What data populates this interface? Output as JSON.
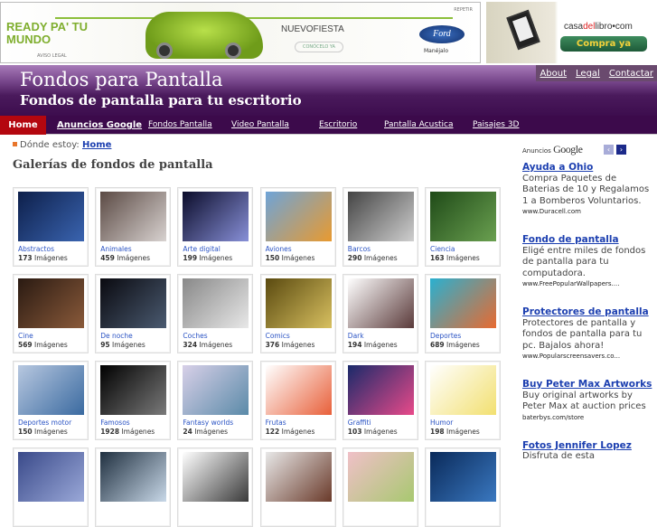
{
  "banner_ad": {
    "headline": "READY PA' TU MUNDO",
    "aviso": "AVISO LEGAL",
    "product": "NUEVOFIESTA",
    "cta": "CONÓCELO YA",
    "brand": "Ford",
    "tagline": "Manéjalo",
    "replay": "REPETIR"
  },
  "side_banner": {
    "brand_a": "casa",
    "brand_b": "del",
    "brand_c": "libro•com",
    "cta": "Compra ya"
  },
  "header": {
    "title": "Fondos para Pantalla",
    "subtitle": "Fondos de pantalla para tu escritorio",
    "links": [
      "About",
      "Legal",
      "Contactar"
    ]
  },
  "nav": {
    "items": [
      "Home",
      "Anuncios Google",
      "Fondos Pantalla",
      "Video Pantalla",
      "Escritorio",
      "Pantalla Acustica",
      "Paisajes 3D"
    ]
  },
  "breadcrumb": {
    "label": "Dónde estoy:",
    "current": "Home"
  },
  "main": {
    "title": "Galerías de fondos de pantalla",
    "count_suffix": " Imágenes",
    "galleries": [
      {
        "name": "Abstractos",
        "count": "173",
        "c1": "#0d1f4a",
        "c2": "#3a64b0"
      },
      {
        "name": "Animales",
        "count": "459",
        "c1": "#5b4a44",
        "c2": "#d8d2d0"
      },
      {
        "name": "Arte digital",
        "count": "199",
        "c1": "#0b0c2a",
        "c2": "#8890d8"
      },
      {
        "name": "Aviones",
        "count": "150",
        "c1": "#6ea4d8",
        "c2": "#e89a30"
      },
      {
        "name": "Barcos",
        "count": "290",
        "c1": "#444444",
        "c2": "#cfcfcf"
      },
      {
        "name": "Ciencia",
        "count": "163",
        "c1": "#1f4a18",
        "c2": "#6aa050"
      },
      {
        "name": "Cine",
        "count": "569",
        "c1": "#2a1a12",
        "c2": "#8a5a3a"
      },
      {
        "name": "De noche",
        "count": "95",
        "c1": "#0a0a10",
        "c2": "#4a5a70"
      },
      {
        "name": "Coches",
        "count": "324",
        "c1": "#888888",
        "c2": "#e8e8e8"
      },
      {
        "name": "Comics",
        "count": "376",
        "c1": "#5a4a10",
        "c2": "#d8c060"
      },
      {
        "name": "Dark",
        "count": "194",
        "c1": "#ffffff",
        "c2": "#5a3a3a"
      },
      {
        "name": "Deportes",
        "count": "689",
        "c1": "#2ab0d0",
        "c2": "#e86a30"
      },
      {
        "name": "Deportes motor",
        "count": "150",
        "c1": "#b8c8e0",
        "c2": "#3a6aa0"
      },
      {
        "name": "Famosos",
        "count": "1928",
        "c1": "#000000",
        "c2": "#7a7a7a"
      },
      {
        "name": "Fantasy worlds",
        "count": "24",
        "c1": "#d8d0e8",
        "c2": "#5a8aa8"
      },
      {
        "name": "Frutas",
        "count": "122",
        "c1": "#ffffff",
        "c2": "#e8603a"
      },
      {
        "name": "Graffiti",
        "count": "103",
        "c1": "#1a2a6a",
        "c2": "#e84a8a"
      },
      {
        "name": "Humor",
        "count": "198",
        "c1": "#ffffff",
        "c2": "#f2e070"
      },
      {
        "name": "",
        "count": "",
        "c1": "#3a4a8a",
        "c2": "#9aa8d8"
      },
      {
        "name": "",
        "count": "",
        "c1": "#203040",
        "c2": "#c8d8e8"
      },
      {
        "name": "",
        "count": "",
        "c1": "#ffffff",
        "c2": "#3a3a3a"
      },
      {
        "name": "",
        "count": "",
        "c1": "#e8e8e8",
        "c2": "#6a3a2a"
      },
      {
        "name": "",
        "count": "",
        "c1": "#f0c0c8",
        "c2": "#a8c870"
      },
      {
        "name": "",
        "count": "",
        "c1": "#0a2a5a",
        "c2": "#3a78c0"
      }
    ]
  },
  "google_ads": {
    "label": "Anuncios",
    "brand": "Google",
    "prev": "‹",
    "next": "›",
    "items": [
      {
        "title": "Ayuda a Ohio",
        "body": "Compra Paquetes de Baterias de 10 y Regalamos 1 a Bomberos Voluntarios.",
        "url": "www.Duracell.com"
      },
      {
        "title": "Fondo de pantalla",
        "body": "Eligé entre miles de fondos de pantalla para tu computadora.",
        "url": "www.FreePopularWallpapers...."
      },
      {
        "title": "Protectores de pantalla",
        "body": "Protectores de pantalla y fondos de pantalla para tu pc. Bajalos ahora!",
        "url": "www.Popularscreensavers.co..."
      },
      {
        "title": "Buy Peter Max Artworks",
        "body": "Buy original artworks by Peter Max at auction prices",
        "url": "baterbys.com/store"
      },
      {
        "title": "Fotos Jennifer Lopez",
        "body": "Disfruta de esta",
        "url": ""
      }
    ]
  }
}
